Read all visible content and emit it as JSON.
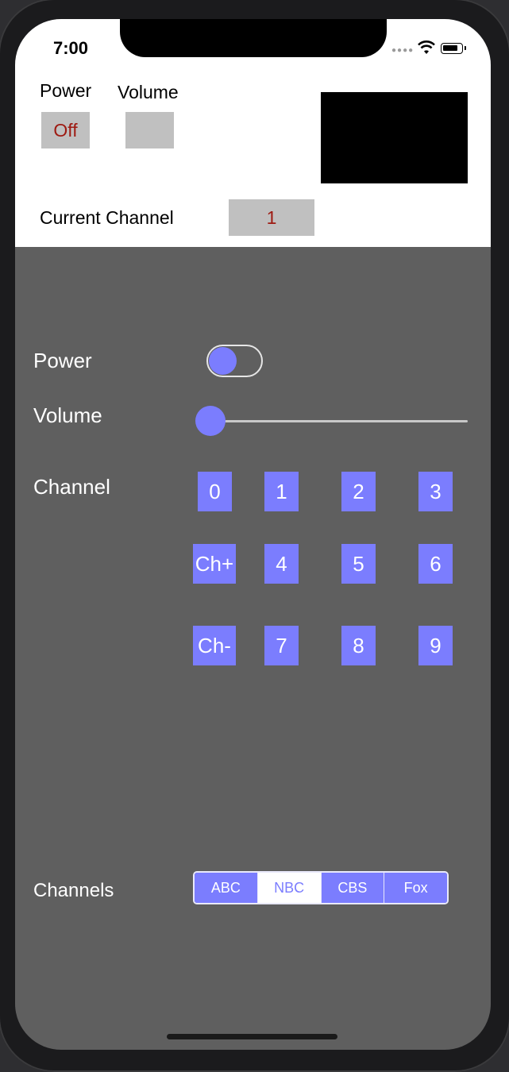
{
  "status_bar": {
    "time": "7:00"
  },
  "display": {
    "power_label": "Power",
    "volume_label": "Volume",
    "power_value": "Off",
    "volume_value": "",
    "current_channel_label": "Current Channel",
    "current_channel_value": "1"
  },
  "controls": {
    "power_label": "Power",
    "power_on": false,
    "volume_label": "Volume",
    "volume_level": 0,
    "channel_label": "Channel",
    "keys": {
      "k0": "0",
      "k1": "1",
      "k2": "2",
      "k3": "3",
      "ch_up": "Ch+",
      "k4": "4",
      "k5": "5",
      "k6": "6",
      "ch_down": "Ch-",
      "k7": "7",
      "k8": "8",
      "k9": "9"
    },
    "channels_label": "Channels",
    "segments": [
      "ABC",
      "NBC",
      "CBS",
      "Fox"
    ],
    "selected_segment": "NBC"
  },
  "colors": {
    "accent": "#7b7dfe",
    "panel_bg": "#5f5f5f",
    "value_text": "#9e1a12",
    "value_box": "#c0c0c0"
  }
}
